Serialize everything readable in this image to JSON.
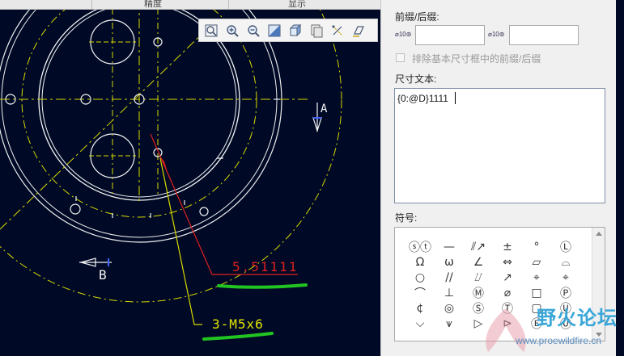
{
  "header": {
    "tab_precision": "精度",
    "tab_display": "显示"
  },
  "toolbar": {
    "buttons": [
      "zoom-fit-icon",
      "zoom-in-icon",
      "zoom-out-icon",
      "shading-icon",
      "view-cube-icon",
      "saved-views-icon",
      "datum-display-icon",
      "annotation-display-icon"
    ]
  },
  "panel": {
    "prefix_suffix_label": "前缀/后缀:",
    "prefix_icon_text": "⌀10⊚",
    "suffix_icon_text": "⌀10⊚",
    "prefix_value": "",
    "suffix_value": "",
    "exclude_label": "排除基本尺寸框中的前缀/后缀",
    "dim_text_label": "尺寸文本:",
    "dim_text_value": "{0:@D}1111",
    "symbols_label": "符号:",
    "symbols": [
      [
        "ⓢⓣ",
        "—",
        "⫽↗",
        "±",
        "°",
        "Ⓛ"
      ],
      [
        "Ω",
        "ω",
        "∠",
        "⇔",
        "▱",
        "⌓"
      ],
      [
        "○",
        "//",
        "⌰",
        "↗",
        "⌖",
        "⌖"
      ],
      [
        "⌒",
        "⊥",
        "Ⓜ",
        "⌀",
        "□",
        "Ⓟ"
      ],
      [
        "¢",
        "◎",
        "Ⓢ",
        "Ⓣ",
        "▢",
        "Ⓤ"
      ],
      [
        "⌵",
        "⩛",
        "▷",
        "⊳",
        "Ⓔ",
        "Ⓤ"
      ]
    ]
  },
  "drawing": {
    "dim_label_1": "5.51111",
    "dim_label_2": "3-M5x6",
    "view_label_a": "A",
    "view_label_b": "B"
  },
  "watermark": {
    "site_name": "野火论坛",
    "site_url": "www.proewildfire.cn"
  },
  "colors": {
    "background": "#000a26",
    "yellow": "#e6e600",
    "red": "#e02020",
    "white": "#f4f4f4",
    "highlight_green": "#22c422"
  }
}
